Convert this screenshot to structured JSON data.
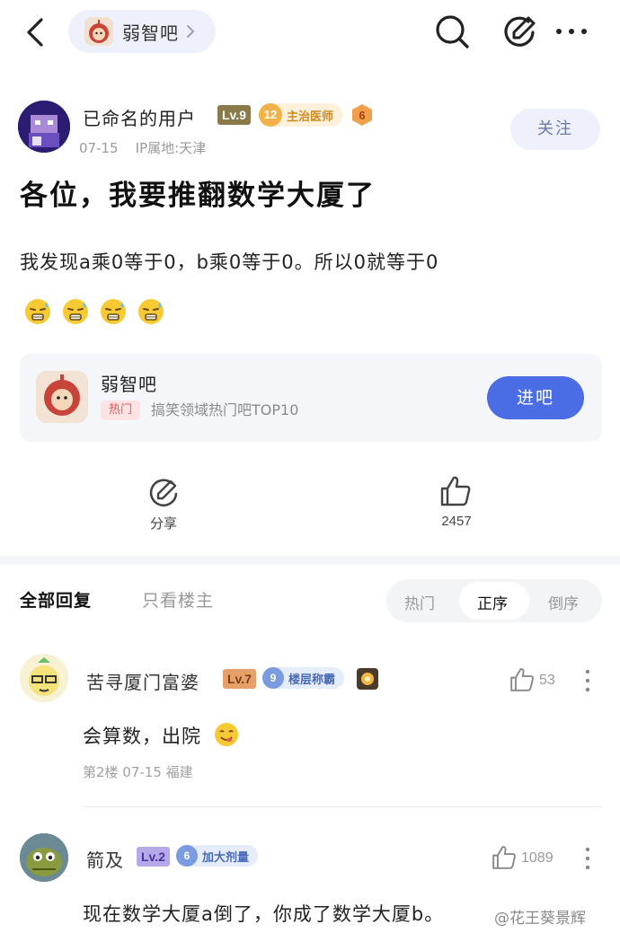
{
  "topbar": {
    "forum_name": "弱智吧"
  },
  "post": {
    "author": {
      "name": "已命名的用户",
      "level": "Lv.9",
      "title_level": "12",
      "title": "主治医师",
      "badge_num": "6"
    },
    "date": "07-15",
    "location": "IP属地:天津",
    "follow_label": "关注",
    "title": "各位，我要推翻数学大厦了",
    "body": "我发现a乘0等于0，b乘0等于0。所以0就等于0",
    "emoji_count": 4
  },
  "forum_card": {
    "name": "弱智吧",
    "tag": "热门",
    "description": "搞笑领域热门吧TOP10",
    "enter_label": "进吧"
  },
  "actions": {
    "share_label": "分享",
    "like_count": "2457"
  },
  "reply_tabs": {
    "all": "全部回复",
    "op_only": "只看楼主",
    "sort_hot": "热门",
    "sort_asc": "正序",
    "sort_desc": "倒序"
  },
  "replies": [
    {
      "name": "苦寻厦门富婆",
      "level": "Lv.7",
      "honor_num": "9",
      "honor": "楼层称霸",
      "likes": "53",
      "text": "会算数，出院",
      "meta": "第2楼  07-15  福建"
    },
    {
      "name": "箭及",
      "level": "Lv.2",
      "honor_num": "6",
      "honor": "加大剂量",
      "likes": "1089",
      "text": "现在数学大厦a倒了，你成了数学大厦b。"
    }
  ],
  "watermark": "@花王葵景辉",
  "colors": {
    "accent": "#4a6de5",
    "pill_bg": "#eef0fb",
    "card_bg": "#f5f6f9",
    "hot_tag": "#e05a5a"
  }
}
